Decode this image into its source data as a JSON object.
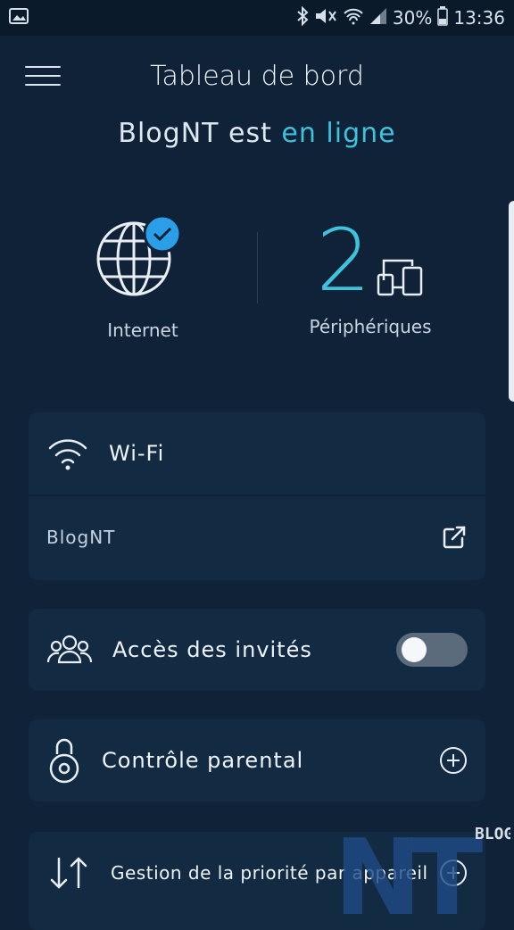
{
  "status_bar": {
    "battery": "30%",
    "time": "13:36"
  },
  "header": {
    "title": "Tableau de bord"
  },
  "network": {
    "name": "BlogNT",
    "status_prefix": "est",
    "status": "en ligne"
  },
  "overview": {
    "internet_label": "Internet",
    "devices_count": "2",
    "devices_label": "Périphériques"
  },
  "wifi": {
    "title": "Wi-Fi",
    "network_name": "BlogNT"
  },
  "guest": {
    "label": "Accès des invités",
    "enabled": false
  },
  "parental": {
    "label": "Contrôle parental"
  },
  "priority": {
    "label": "Gestion de la priorité par appareil"
  },
  "watermark": {
    "letters": "NT",
    "tag": "BLOG"
  },
  "colors": {
    "background": "#0f2237",
    "card": "#132a43",
    "accent": "#3fc2dc",
    "check_badge": "#2a9ee6"
  },
  "icons": [
    "image-icon",
    "bluetooth-icon",
    "mute-icon",
    "wifi-signal-icon",
    "cell-signal-icon",
    "battery-icon",
    "menu-icon",
    "globe-icon",
    "check-badge-icon",
    "devices-icon",
    "wifi-icon",
    "external-link-icon",
    "guests-icon",
    "lock-icon",
    "plus-icon",
    "sort-arrows-icon"
  ]
}
